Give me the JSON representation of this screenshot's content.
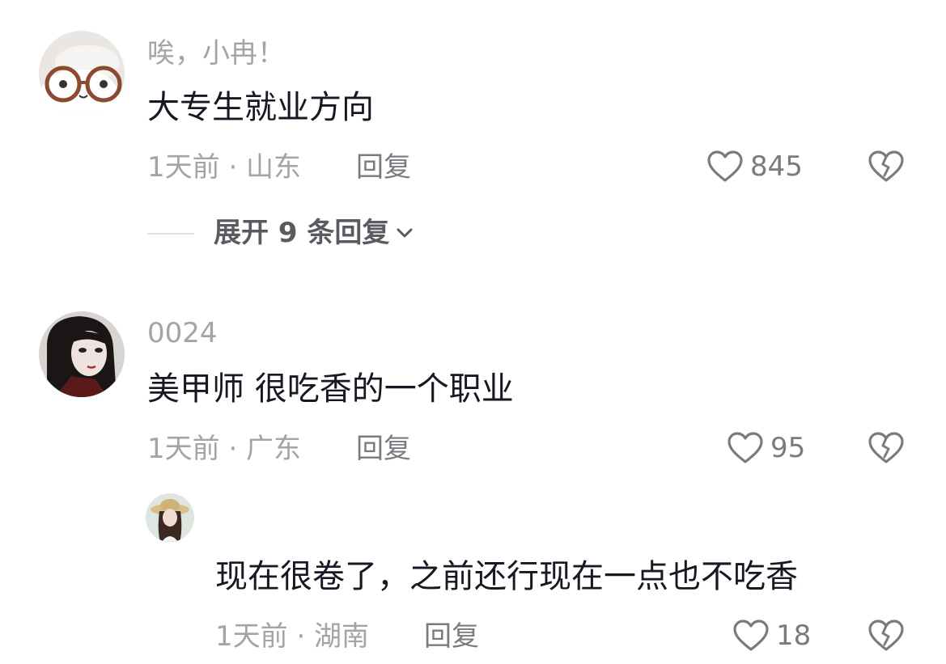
{
  "comments": [
    {
      "username": "唉，小冉！",
      "text": "大专生就业方向",
      "meta": "1天前 · 山东",
      "reply_label": "回复",
      "likes": "845",
      "expand_label": "展开 9 条回复",
      "avatar_icon": "glasses-cloud-avatar"
    },
    {
      "username": "0024",
      "text": "美甲师 很吃香的一个职业",
      "meta": "1天前 · 广东",
      "reply_label": "回复",
      "likes": "95",
      "avatar_icon": "dark-hair-girl-avatar",
      "replies": [
        {
          "text": "现在很卷了，之前还行现在一点也不吃香",
          "meta": "1天前 · 湖南",
          "reply_label": "回复",
          "likes": "18",
          "avatar_icon": "straw-hat-girl-avatar"
        }
      ]
    }
  ],
  "colors": {
    "text_primary": "#161823",
    "text_secondary": "#a3a3a8",
    "text_action": "#7a7a80",
    "icon": "#7a7a80"
  }
}
